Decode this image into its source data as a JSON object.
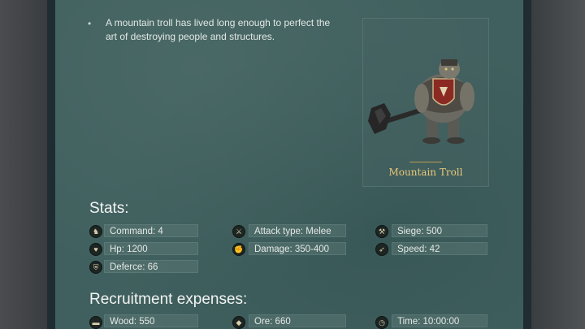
{
  "unit": {
    "description": "A mountain troll has lived long enough to perfect the art of destroying people and structures.",
    "bullet": "•",
    "name": "Mountain Troll"
  },
  "stats": {
    "title": "Stats:",
    "items": [
      {
        "icon": "command-icon",
        "glyph": "♞",
        "label": "Command: 4"
      },
      {
        "icon": "attack-type-icon",
        "glyph": "⚔",
        "label": "Attack type: Melee"
      },
      {
        "icon": "siege-icon",
        "glyph": "⚒",
        "label": "Siege: 500"
      },
      {
        "icon": "heart-icon",
        "glyph": "♥",
        "label": "Hp: 1200"
      },
      {
        "icon": "damage-icon",
        "glyph": "✊",
        "label": "Damage: 350-400"
      },
      {
        "icon": "speed-icon",
        "glyph": "➶",
        "label": "Speed: 42"
      },
      {
        "icon": "shield-icon",
        "glyph": "⛨",
        "label": "Deferce: 66"
      }
    ]
  },
  "recruitment": {
    "title": "Recruitment expenses:",
    "items": [
      {
        "icon": "wood-icon",
        "glyph": "▬",
        "label": "Wood: 550"
      },
      {
        "icon": "ore-icon",
        "glyph": "◆",
        "label": "Ore: 660"
      },
      {
        "icon": "clock-icon",
        "glyph": "◷",
        "label": "Time: 10:00:00"
      }
    ]
  }
}
